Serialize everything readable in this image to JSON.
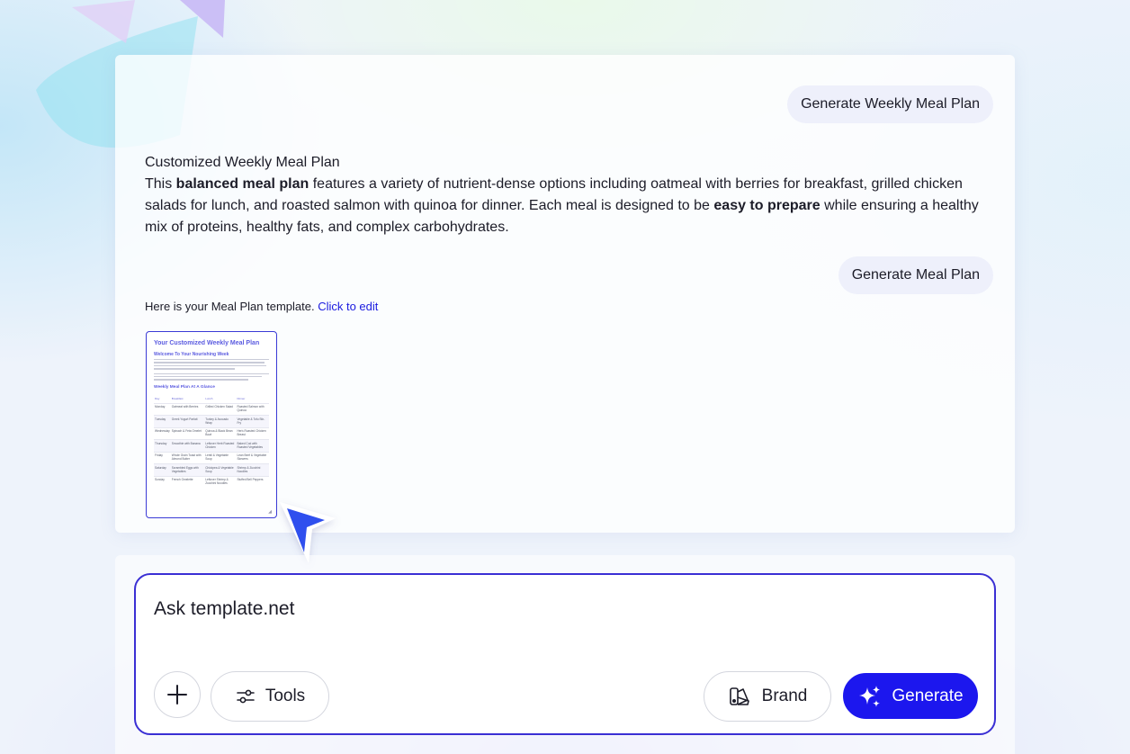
{
  "chat": {
    "user_message_1": "Generate Weekly Meal Plan",
    "answer": {
      "title": "Customized Weekly Meal Plan",
      "intro": "This ",
      "bold_1": "balanced meal plan",
      "mid": " features a variety of nutrient-dense options including oatmeal with berries for breakfast, grilled chicken salads for lunch, and roasted salmon with quinoa for dinner. Each meal is designed to be ",
      "bold_2": "easy to prepare",
      "end": " while ensuring a healthy mix of proteins, healthy fats, and complex carbohydrates."
    },
    "user_message_2": "Generate Meal Plan",
    "template_text": "Here is your Meal Plan template. ",
    "template_link": "Click to edit"
  },
  "thumbnail": {
    "title": "Your Customized Weekly Meal Plan",
    "subtitle": "Welcome To Your Nourishing Week",
    "section": "Weekly Meal Plan At A Glance",
    "headers": [
      "Day",
      "Breakfast",
      "Lunch",
      "Dinner"
    ],
    "rows": [
      [
        "Monday",
        "Oatmeal with Berries",
        "Grilled Chicken Salad",
        "Roasted Salmon with Quinoa"
      ],
      [
        "Tuesday",
        "Greek Yogurt Parfait",
        "Turkey & Avocado Wrap",
        "Vegetable & Tofu Stir-Fry"
      ],
      [
        "Wednesday",
        "Spinach & Feta Omelet",
        "Quinoa & Black Bean Bowl",
        "Herb-Roasted Chicken Breast"
      ],
      [
        "Thursday",
        "Smoothie with Banana",
        "Leftover Herb Roasted Chicken",
        "Baked Cod with Roasted Vegetables"
      ],
      [
        "Friday",
        "Whole Grain Toast with Almond Butter",
        "Lentil & Vegetable Soup",
        "Lean Beef & Vegetable Skewers"
      ],
      [
        "Saturday",
        "Scrambled Eggs with Vegetables",
        "Chickpea & Vegetable Soup",
        "Shrimp & Zucchini Noodles"
      ],
      [
        "Sunday",
        "French Omelette",
        "Leftover Shrimp & Zucchini Noodles",
        "Stuffed Bell Peppers"
      ]
    ]
  },
  "composer": {
    "placeholder": "Ask template.net",
    "tools_label": "Tools",
    "brand_label": "Brand",
    "generate_label": "Generate"
  },
  "colors": {
    "accent": "#1c17ee",
    "border_accent": "#3a2fd4",
    "link": "#1a1adf",
    "bubble_bg": "#eef0fb"
  },
  "icons": {
    "plus": "plus-icon",
    "tools": "sliders-icon",
    "brand": "palette-icon",
    "generate": "sparkles-icon",
    "cursor": "cursor-arrow-icon"
  }
}
